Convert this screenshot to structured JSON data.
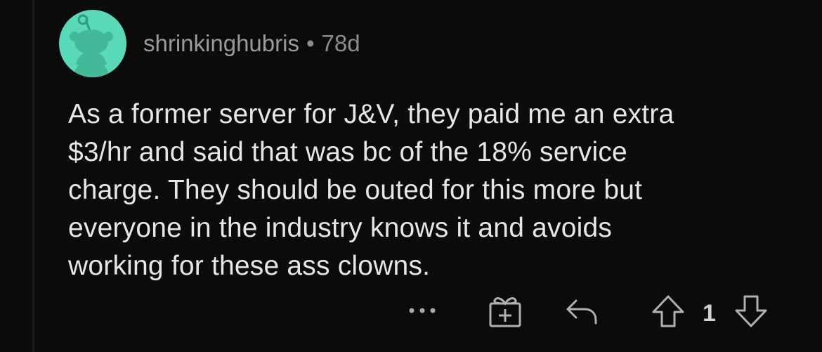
{
  "comment": {
    "username": "shrinkinghubris",
    "separator": "•",
    "age": "78d",
    "body": "As a former server for J&V, they paid me an extra\n$3/hr and said that was bc of the 18% service\ncharge.  They should be outed for this more but\neveryone in the industry knows it and avoids\nworking for these ass clowns.",
    "score": "1",
    "avatar_color": "#59d9b7"
  },
  "actions": {
    "more_icon": "ellipsis-icon",
    "award_icon": "gift-icon",
    "reply_icon": "reply-icon",
    "upvote_icon": "upvote-icon",
    "downvote_icon": "downvote-icon"
  }
}
